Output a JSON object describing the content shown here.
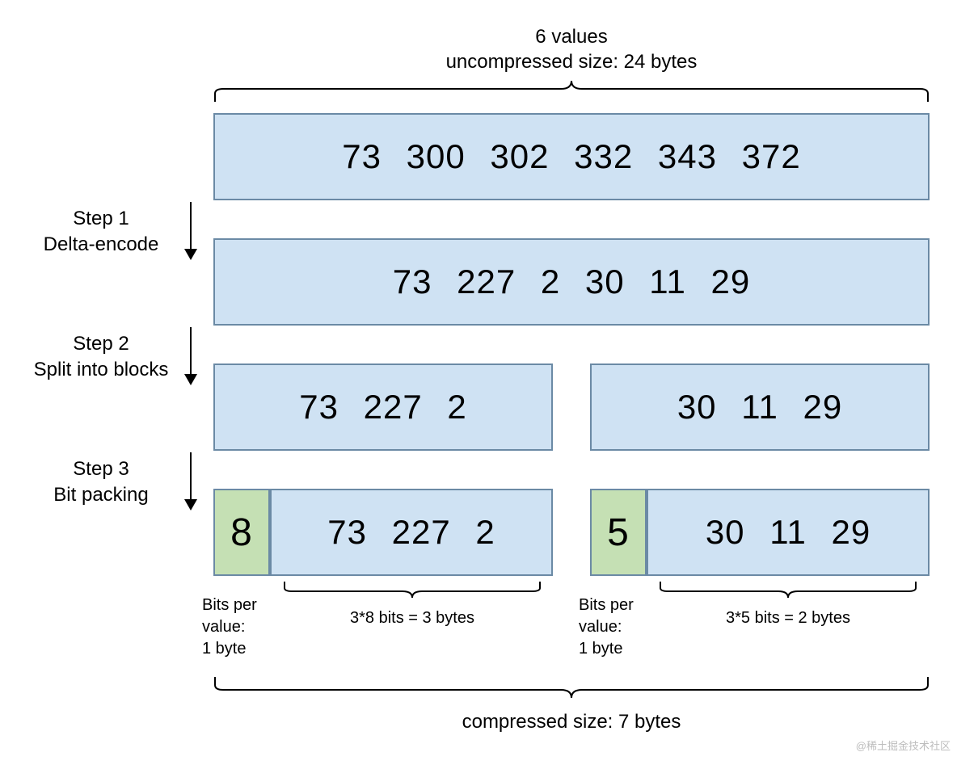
{
  "header": {
    "line1": "6 values",
    "line2": "uncompressed size: 24 bytes"
  },
  "row1": {
    "values": "73  300  302  332  343  372"
  },
  "row2": {
    "values": "73  227  2  30  11  29"
  },
  "row3": {
    "left": "73  227  2",
    "right": "30  11  29"
  },
  "row4": {
    "leftBits": "8",
    "leftVals": "73  227  2",
    "rightBits": "5",
    "rightVals": "30  11  29"
  },
  "steps": {
    "s1l1": "Step 1",
    "s1l2": "Delta-encode",
    "s2l1": "Step 2",
    "s2l2": "Split into blocks",
    "s3l1": "Step 3",
    "s3l2": "Bit packing"
  },
  "labels": {
    "bpvL1": "Bits per",
    "bpvL2": "value:",
    "bpvL3": "1 byte",
    "leftCalc": "3*8 bits = 3 bytes",
    "rightCalc": "3*5 bits = 2 bytes"
  },
  "footer": "compressed size: 7 bytes",
  "watermark": "@稀土掘金技术社区"
}
